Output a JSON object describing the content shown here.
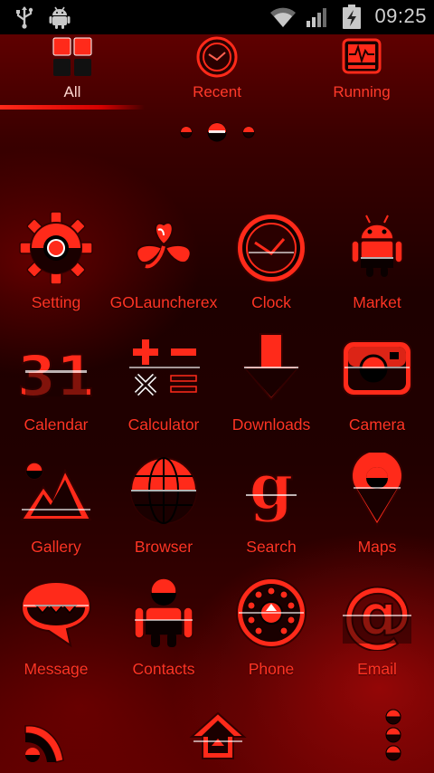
{
  "status_bar": {
    "time": "09:25",
    "icons": [
      "usb-icon",
      "android-debug-icon",
      "wifi-icon",
      "signal-icon",
      "battery-charging-icon"
    ]
  },
  "tabs": [
    {
      "label": "All",
      "icon": "apps-grid-icon",
      "active": true
    },
    {
      "label": "Recent",
      "icon": "clock-icon",
      "active": false
    },
    {
      "label": "Running",
      "icon": "monitor-pulse-icon",
      "active": false
    }
  ],
  "page_indicator": {
    "pages": 3,
    "current": 2
  },
  "apps": [
    {
      "label": "Setting",
      "icon": "gear-icon"
    },
    {
      "label": "GOLauncherex",
      "icon": "heart-clover-icon"
    },
    {
      "label": "Clock",
      "icon": "clock-icon"
    },
    {
      "label": "Market",
      "icon": "android-robot-icon"
    },
    {
      "label": "Calendar",
      "icon": "calendar-31-icon"
    },
    {
      "label": "Calculator",
      "icon": "calculator-icon"
    },
    {
      "label": "Downloads",
      "icon": "download-arrow-icon"
    },
    {
      "label": "Camera",
      "icon": "camera-icon"
    },
    {
      "label": "Gallery",
      "icon": "mountains-icon"
    },
    {
      "label": "Browser",
      "icon": "globe-icon"
    },
    {
      "label": "Search",
      "icon": "google-g-icon"
    },
    {
      "label": "Maps",
      "icon": "map-pin-icon"
    },
    {
      "label": "Message",
      "icon": "speech-bubble-icon"
    },
    {
      "label": "Contacts",
      "icon": "person-icon"
    },
    {
      "label": "Phone",
      "icon": "rotary-dial-icon"
    },
    {
      "label": "Email",
      "icon": "at-sign-icon"
    }
  ],
  "dock": [
    "phone-handset-icon",
    "home-icon",
    "menu-dots-icon"
  ],
  "colors": {
    "accent": "#ff2a1a",
    "label": "#ff3424",
    "background": "#200000"
  }
}
